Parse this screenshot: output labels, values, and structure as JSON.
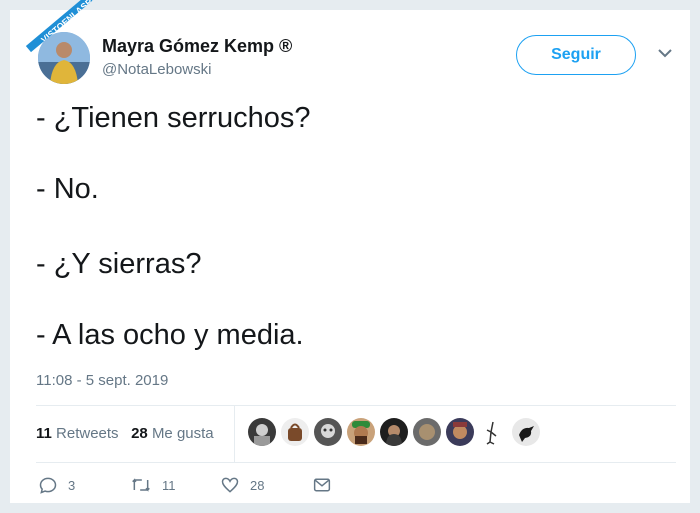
{
  "watermark": {
    "text": "VISTOENLASREDES",
    "sub": ".com"
  },
  "tweet": {
    "author_name": "Mayra Gómez Kemp ®",
    "author_handle": "@NotaLebowski",
    "follow_label": "Seguir",
    "lines": [
      "- ¿Tienen serruchos?",
      "- No.",
      "- ¿Y sierras?",
      "- A las ocho y media."
    ],
    "timestamp": "11:08 - 5 sept. 2019",
    "retweets_count": "11",
    "retweets_label": "Retweets",
    "likes_count": "28",
    "likes_label": "Me gusta",
    "actions": {
      "replies": "3",
      "retweets": "11",
      "likes": "28"
    }
  },
  "colors": {
    "accent": "#1da1f2",
    "muted": "#657786",
    "text": "#14171a",
    "ribbon": "#1f8fd6"
  },
  "icons": [
    "chevron-down-icon",
    "reply-icon",
    "retweet-icon",
    "heart-icon",
    "message-icon"
  ]
}
